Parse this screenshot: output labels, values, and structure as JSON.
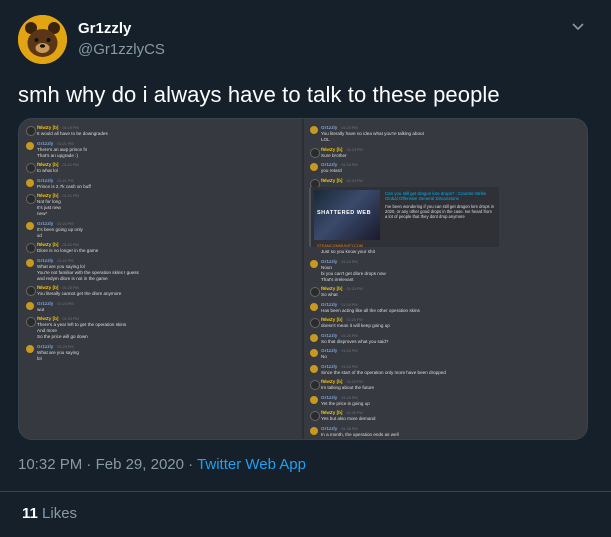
{
  "tweet": {
    "display_name": "Gr1zzly",
    "handle": "@Gr1zzlyCS",
    "text": "smh why do i always have to talk to these people",
    "time": "10:32 PM",
    "separator": "·",
    "date": "Feb 29, 2020",
    "source": "Twitter Web App",
    "likes_count": "11",
    "likes_label": "Likes"
  },
  "chat": {
    "left": [
      {
        "author": "f6lwZy [b]",
        "color": "b",
        "ts": "01:19 PM",
        "lines": [
          "It would all have to be downgrades"
        ]
      },
      {
        "author": "Gr1zzly",
        "color": "g",
        "ts": "01:21 PM",
        "lines": [
          "There's an awp prince fn",
          "That's an upgrade :)"
        ]
      },
      {
        "author": "f6lwZy [b]",
        "color": "b",
        "ts": "01:21 PM",
        "lines": [
          "to what lol"
        ]
      },
      {
        "author": "Gr1zzly",
        "color": "g",
        "ts": "01:21 PM",
        "lines": [
          "Prince is 2.7k cash on buff"
        ]
      },
      {
        "author": "f6lwZy [b]",
        "color": "b",
        "ts": "01:21 PM",
        "lines": [
          "Not for long",
          "It's just new",
          "new*"
        ]
      },
      {
        "author": "Gr1zzly",
        "color": "g",
        "ts": "01:22 PM",
        "lines": [
          "It's been going up only",
          "xd"
        ]
      },
      {
        "author": "f6lwZy [b]",
        "color": "b",
        "ts": "01:22 PM",
        "lines": [
          "Dlore is no longer in the game"
        ]
      },
      {
        "author": "Gr1zzly",
        "color": "g",
        "ts": "01:22 PM",
        "lines": [
          "What are you saying lol",
          "You're not familiar with the operation skins I guess",
          "and redym dlore is not in the game"
        ]
      },
      {
        "author": "f6lwZy [b]",
        "color": "b",
        "ts": "01:23 PM",
        "lines": [
          "You literally cannot get the dlore anymore"
        ]
      },
      {
        "author": "Gr1zzly",
        "color": "g",
        "ts": "01:23 PM",
        "lines": [
          "wut"
        ]
      },
      {
        "author": "f6lwZy [b]",
        "color": "b",
        "ts": "01:23 PM",
        "lines": [
          "There's a year left to get the operation skins",
          "And more",
          "So the price will go down"
        ]
      },
      {
        "author": "Gr1zzly",
        "color": "g",
        "ts": "01:23 PM",
        "lines": [
          "What are you saying",
          "lol"
        ]
      }
    ],
    "right_top": [
      {
        "author": "Gr1zzly",
        "color": "g",
        "ts": "01:23 PM",
        "lines": [
          "You literally have no idea what you're talking about",
          "LOL"
        ]
      },
      {
        "author": "f6lwZy [b]",
        "color": "b",
        "ts": "01:23 PM",
        "lines": [
          "Sure brother"
        ]
      },
      {
        "author": "Gr1zzly",
        "color": "g",
        "ts": "01:24 PM",
        "lines": [
          "you retard"
        ]
      },
      {
        "author": "f6lwZy [b]",
        "color": "b",
        "ts": "01:24 PM",
        "lines": []
      }
    ],
    "embed": {
      "image_text": "SHATTERED WEB",
      "title": "Can you still get dragon lore drops? : Counter-Strike Global Offensive General Discussions",
      "description": "I've been wondering if you can still get dragon lore drops in 2020, or any other good drops in the case. Ive heard from a lot of people that they dont drop anymore",
      "link": "STEAMCOMMUNITY.COM"
    },
    "right_bottom": [
      {
        "author": "",
        "color": "b",
        "ts": "",
        "lines": [
          "Just so you know your shit"
        ]
      },
      {
        "author": "Gr1zzly",
        "color": "g",
        "ts": "01:24 PM",
        "lines": [
          "Noun",
          "bi you can't get dlore drops now",
          "That's irrelevant"
        ]
      },
      {
        "author": "f6lwZy [b]",
        "color": "b",
        "ts": "01:24 PM",
        "lines": [
          "So what"
        ]
      },
      {
        "author": "Gr1zzly",
        "color": "g",
        "ts": "01:24 PM",
        "lines": [
          "Has been acting like all the other operation skins"
        ]
      },
      {
        "author": "f6lwZy [b]",
        "color": "b",
        "ts": "01:25 PM",
        "lines": [
          "doesn't mean it will keep going up"
        ]
      },
      {
        "author": "Gr1zzly",
        "color": "g",
        "ts": "01:25 PM",
        "lines": [
          "So that disproves what you said?"
        ]
      },
      {
        "author": "Gr1zzly",
        "color": "g",
        "ts": "01:25 PM",
        "lines": [
          "No"
        ]
      },
      {
        "author": "Gr1zzly",
        "color": "g",
        "ts": "01:25 PM",
        "lines": [
          "Since the start of the operation only more have been dropped"
        ]
      },
      {
        "author": "f6lwZy [b]",
        "color": "b",
        "ts": "01:25 PM",
        "lines": [
          "Im talking about the future"
        ]
      },
      {
        "author": "Gr1zzly",
        "color": "g",
        "ts": "01:25 PM",
        "lines": [
          "Yet the price is going up"
        ]
      },
      {
        "author": "f6lwZy [b]",
        "color": "b",
        "ts": "01:26 PM",
        "lines": [
          "Yes but also more demand"
        ]
      },
      {
        "author": "Gr1zzly",
        "color": "g",
        "ts": "01:26 PM",
        "lines": [
          "In a month, the operation ends as well"
        ]
      }
    ]
  }
}
